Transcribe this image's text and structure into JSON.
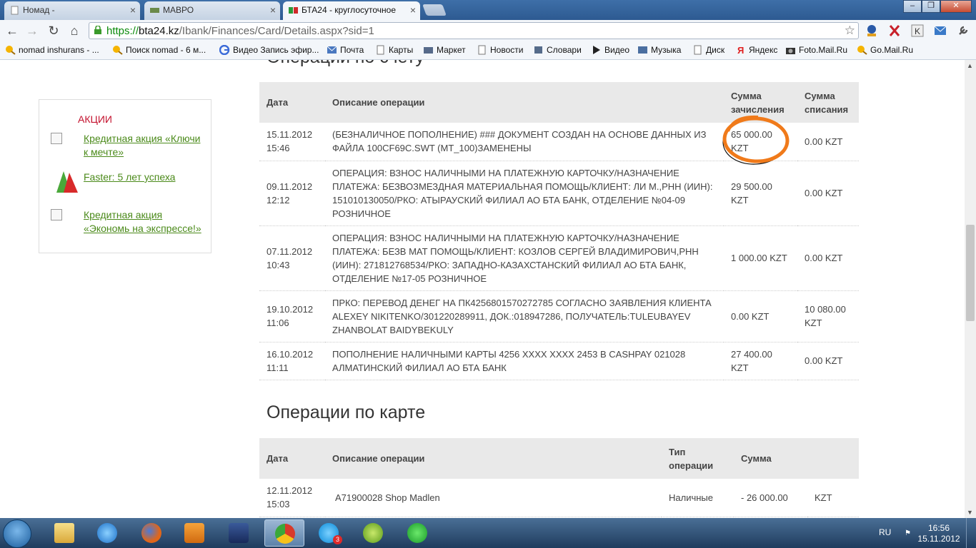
{
  "browser": {
    "tabs": [
      {
        "title": "Номад -",
        "active": false
      },
      {
        "title": "МАВРО",
        "active": false
      },
      {
        "title": "БТА24 - круглосуточное",
        "active": true
      }
    ],
    "url": {
      "scheme": "https://",
      "host": "bta24.kz",
      "path": "/Ibank/Finances/Card/Details.aspx?sid=1"
    },
    "bookmarks": [
      {
        "label": "nomad inshurans - ...",
        "icon": "search-icon"
      },
      {
        "label": "Поиск nomad - 6 м...",
        "icon": "search-icon"
      },
      {
        "label": "Видео Запись эфир...",
        "icon": "google-icon"
      },
      {
        "label": "Почта",
        "icon": "mail-icon"
      },
      {
        "label": "Карты",
        "icon": "page-icon"
      },
      {
        "label": "Маркет",
        "icon": "market-icon"
      },
      {
        "label": "Новости",
        "icon": "page-icon"
      },
      {
        "label": "Словари",
        "icon": "book-icon"
      },
      {
        "label": "Видео",
        "icon": "play-icon"
      },
      {
        "label": "Музыка",
        "icon": "music-icon"
      },
      {
        "label": "Диск",
        "icon": "page-icon"
      },
      {
        "label": "Яндекс",
        "icon": "yandex-icon"
      },
      {
        "label": "Foto.Mail.Ru",
        "icon": "camera-icon"
      },
      {
        "label": "Go.Mail.Ru",
        "icon": "search-icon"
      }
    ]
  },
  "sidebar": {
    "title": "АКЦИИ",
    "items": [
      {
        "label": "Кредитная акция «Ключи к мечте»"
      },
      {
        "label": "Faster: 5 лет успеха"
      },
      {
        "label": "Кредитная акция «Экономь на экспрессе!»"
      }
    ]
  },
  "account_ops": {
    "heading": "Операции по счету",
    "headers": {
      "date": "Дата",
      "description": "Описание операции",
      "credit": "Сумма зачисления",
      "debit": "Сумма списания"
    },
    "rows": [
      {
        "date": "15.11.2012 15:46",
        "description": "(БЕЗНАЛИЧНОЕ ПОПОЛНЕНИЕ) ### ДОКУМЕНТ СОЗДАН НА ОСНОВЕ ДАННЫХ ИЗ ФАЙЛА 100CF69C.SWT (MT_100)ЗАМЕНЕНЫ",
        "credit": "65 000.00 KZT",
        "debit": "0.00  KZT"
      },
      {
        "date": "09.11.2012 12:12",
        "description": "ОПЕРАЦИЯ: ВЗНОС НАЛИЧНЫМИ НА ПЛАТЕЖНУЮ КАРТОЧКУ/НАЗНАЧЕНИЕ ПЛАТЕЖА: БЕЗВОЗМЕЗДНАЯ МАТЕРИАЛЬНАЯ ПОМОЩЬ/КЛИЕНТ: ЛИ М.,РНН (ИИН): 151010130050/РКО: АТЫРАУСКИЙ ФИЛИАЛ АО БТА БАНК, ОТДЕЛЕНИЕ №04-09 РОЗНИЧНОЕ",
        "credit": "29 500.00 KZT",
        "debit": "0.00  KZT"
      },
      {
        "date": "07.11.2012 10:43",
        "description": "ОПЕРАЦИЯ: ВЗНОС НАЛИЧНЫМИ НА ПЛАТЕЖНУЮ КАРТОЧКУ/НАЗНАЧЕНИЕ ПЛАТЕЖА: БЕЗВ МАТ ПОМОЩЬ/КЛИЕНТ: КОЗЛОВ СЕРГЕЙ ВЛАДИМИРОВИЧ,РНН (ИИН): 271812768534/РКО: ЗАПАДНО-КАЗАХСТАНСКИЙ ФИЛИАЛ АО БТА БАНК, ОТДЕЛЕНИЕ №17-05 РОЗНИЧНОЕ",
        "credit": "1 000.00 KZT",
        "debit": "0.00  KZT"
      },
      {
        "date": "19.10.2012 11:06",
        "description": "ПРКО: ПЕРЕВОД ДЕНЕГ НА ПК4256801570272785 СОГЛАСНО ЗАЯВЛЕНИЯ КЛИЕНТА ALEXEY NIKITENKO/301220289911, ДОК.:018947286, ПОЛУЧАТЕЛЬ:TULEUBAYEV ZHANBOLAT BAIDYBEKULY",
        "credit": "0.00  KZT",
        "debit": "10 080.00 KZT"
      },
      {
        "date": "16.10.2012 11:11",
        "description": "ПОПОЛНЕНИЕ НАЛИЧНЫМИ КАРТЫ 4256 XXXX XXXX 2453 В CASHPAY 021028 АЛМАТИНСКИЙ ФИЛИАЛ АО БТА БАНК",
        "credit": "27 400.00 KZT",
        "debit": "0.00  KZT"
      }
    ]
  },
  "card_ops": {
    "heading": "Операции по карте",
    "headers": {
      "date": "Дата",
      "description": "Описание операции",
      "type": "Тип операции",
      "amount": "Сумма"
    },
    "rows": [
      {
        "date": "12.11.2012 15:03",
        "description": "A71900028 Shop Madlen",
        "type": "Наличные",
        "amount": "- 26 000.00",
        "currency": "KZT"
      }
    ]
  },
  "taskbar": {
    "apps": [
      "explorer",
      "ie",
      "firefox",
      "media",
      "app",
      "chrome",
      "skype",
      "app2",
      "icq"
    ],
    "skype_badge": "3",
    "lang": "RU",
    "time": "16:56",
    "date": "15.11.2012"
  },
  "colors": {
    "accent_green": "#4b8a1a",
    "promo_red": "#c4122e",
    "circle": "#f07a1a"
  }
}
